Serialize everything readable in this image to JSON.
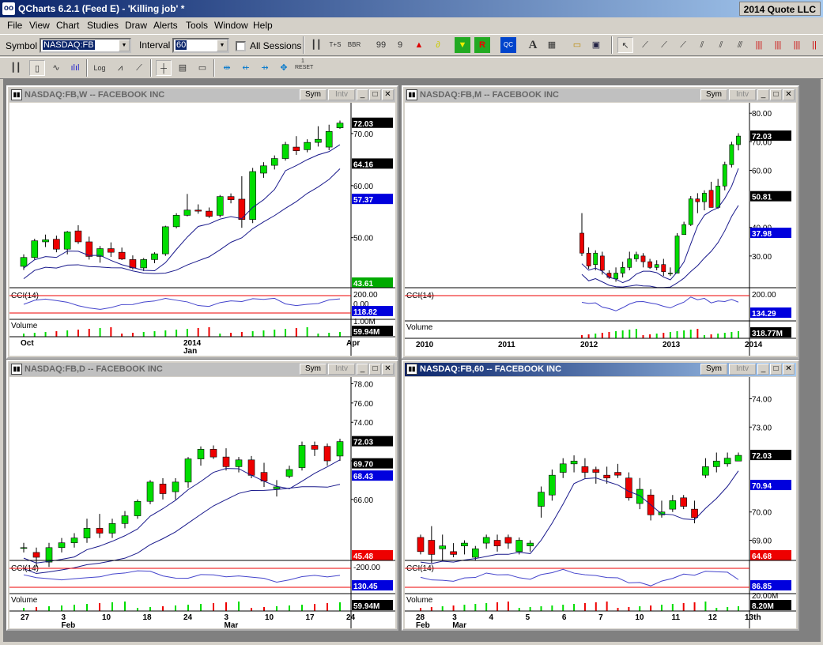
{
  "app": {
    "title": "QCharts 6.2.1 (Feed E) - 'Killing job' *",
    "vendor": "2014 Quote LLC"
  },
  "menu": [
    "File",
    "View",
    "Chart",
    "Studies",
    "Draw",
    "Alerts",
    "Tools",
    "Window",
    "Help"
  ],
  "toolbar": {
    "symbol_label": "Symbol",
    "symbol_value": "NASDAQ:FB",
    "interval_label": "Interval",
    "interval_value": "60",
    "all_sessions_label": "All Sessions",
    "reset_label": "RESET"
  },
  "colors": {
    "up": "#00dd00",
    "down": "#ee0000",
    "ma": "#1a1a8c",
    "cci": "#4444cc",
    "price_tag": "#000000",
    "ma_tag": "#0000dd",
    "low_tag": "#ee0000"
  },
  "charts": [
    {
      "id": "weekly",
      "title": "NASDAQ:FB,W -- FACEBOOK INC",
      "sym": "Sym",
      "intv": "Intv",
      "active": false,
      "chart_data": {
        "type": "candlestick",
        "interval": "W",
        "y_ticks": [
          50,
          60,
          70
        ],
        "y_tick_labels": [
          "50.00",
          "60.00",
          "70.00"
        ],
        "ylim": [
          41,
          75
        ],
        "last_price": "72.03",
        "ma_values": [
          "64.16",
          "57.37"
        ],
        "low_value": "43.61",
        "x_ticks": [
          "Oct",
          "2014\nJan",
          "Apr"
        ],
        "candles": [
          [
            44.5,
            46.8,
            43.8,
            46.2
          ],
          [
            46.2,
            49.8,
            45.8,
            49.4
          ],
          [
            49.2,
            50.6,
            48.2,
            49.6
          ],
          [
            49.7,
            50.4,
            47.2,
            47.8
          ],
          [
            47.8,
            51.3,
            46.8,
            51.1
          ],
          [
            51.3,
            52.4,
            48.8,
            49.2
          ],
          [
            49.2,
            50.2,
            45.8,
            46.4
          ],
          [
            46.4,
            48.4,
            45.2,
            47.9
          ],
          [
            47.9,
            49.1,
            46.3,
            47.2
          ],
          [
            47.2,
            48.1,
            45.7,
            45.9
          ],
          [
            45.8,
            46.6,
            43.9,
            44.2
          ],
          [
            44.2,
            46.1,
            43.6,
            45.8
          ],
          [
            45.8,
            47.2,
            45.1,
            46.9
          ],
          [
            46.9,
            52.3,
            46.5,
            52.1
          ],
          [
            52.1,
            54.7,
            51.8,
            54.3
          ],
          [
            54.3,
            58.4,
            54.1,
            55.3
          ],
          [
            55.3,
            56.4,
            54.6,
            55.1
          ],
          [
            55.1,
            55.8,
            53.8,
            54.1
          ],
          [
            54.3,
            58.2,
            53.9,
            57.9
          ],
          [
            57.9,
            58.5,
            56.6,
            57.3
          ],
          [
            57.4,
            61.8,
            51.9,
            53.5
          ],
          [
            53.5,
            63.4,
            52.8,
            62.7
          ],
          [
            62.4,
            64.5,
            61.5,
            63.8
          ],
          [
            63.9,
            65.8,
            63.1,
            65.2
          ],
          [
            65.2,
            68.4,
            64.8,
            67.9
          ],
          [
            67.4,
            69.5,
            65.9,
            66.7
          ],
          [
            66.9,
            68.9,
            66.4,
            68.3
          ],
          [
            68.3,
            71.4,
            67.5,
            68.9
          ],
          [
            67.4,
            71.7,
            66.8,
            70.4
          ],
          [
            71.1,
            72.5,
            70.9,
            72.0
          ]
        ],
        "cci": {
          "label": "CCI(14)",
          "last": "118.82",
          "levels": [
            "200.00",
            "0.00"
          ]
        },
        "volume": {
          "label": "Volume",
          "last": "59.94M",
          "scale": "1.00M"
        }
      }
    },
    {
      "id": "monthly",
      "title": "NASDAQ:FB,M -- FACEBOOK INC",
      "sym": "Sym",
      "intv": "Intv",
      "active": false,
      "chart_data": {
        "type": "candlestick",
        "interval": "M",
        "y_ticks": [
          30,
          40,
          60,
          70,
          80
        ],
        "y_tick_labels": [
          "30.00",
          "40.00",
          "60.00",
          "70.00",
          "80.00"
        ],
        "ylim": [
          20,
          82
        ],
        "last_price": "72.03",
        "ma_values": [
          "50.81",
          "37.98"
        ],
        "x_ticks": [
          "2010",
          "2011",
          "2012",
          "2013",
          "2014"
        ],
        "candles": [
          [
            38,
            45,
            30,
            31
          ],
          [
            31,
            33,
            25.5,
            26.5
          ],
          [
            27,
            32,
            25,
            31
          ],
          [
            30,
            31.5,
            23.5,
            25
          ],
          [
            24,
            25,
            22,
            22.5
          ],
          [
            22,
            26,
            21,
            24
          ],
          [
            24,
            28,
            22.5,
            26
          ],
          [
            26,
            31.5,
            25,
            29
          ],
          [
            29,
            31.5,
            28,
            30.5
          ],
          [
            30,
            31,
            26,
            28
          ],
          [
            28,
            29,
            25.5,
            26
          ],
          [
            26,
            28.5,
            25,
            27
          ],
          [
            27,
            29,
            23,
            24.5
          ],
          [
            24,
            26,
            23,
            24
          ],
          [
            24,
            38,
            24,
            37
          ],
          [
            37.5,
            42,
            37.5,
            41
          ],
          [
            41,
            51,
            40.5,
            50
          ],
          [
            50,
            52,
            45,
            49
          ],
          [
            49,
            53,
            46,
            52
          ],
          [
            53,
            56,
            47,
            47
          ],
          [
            47,
            57,
            46.5,
            54.5
          ],
          [
            54.5,
            63,
            53,
            62
          ],
          [
            62,
            70,
            61,
            69
          ],
          [
            69,
            73,
            67,
            72
          ]
        ],
        "cci": {
          "label": "CCI(14)",
          "last": "134.29",
          "levels": [
            "200.00"
          ]
        },
        "volume": {
          "label": "Volume",
          "last": "318.77M"
        }
      }
    },
    {
      "id": "daily",
      "title": "NASDAQ:FB,D -- FACEBOOK INC",
      "sym": "Sym",
      "intv": "Intv",
      "active": false,
      "chart_data": {
        "type": "candlestick",
        "interval": "D",
        "y_ticks": [
          66,
          70,
          74,
          76,
          78
        ],
        "y_tick_labels": [
          "66.00",
          "70.00",
          "74.00",
          "76.00",
          "78.00"
        ],
        "ylim": [
          60,
          78.2
        ],
        "last_price": "72.03",
        "ma_values": [
          "69.70",
          "68.43"
        ],
        "low_value": "45.48",
        "x_ticks": [
          "27",
          "3\nFeb",
          "10",
          "18",
          "24",
          "3\nMar",
          "10",
          "17",
          "24"
        ],
        "candles": [
          [
            61,
            61.5,
            60.5,
            61
          ],
          [
            60.5,
            61,
            59,
            60
          ],
          [
            59.5,
            61.5,
            59,
            61
          ],
          [
            61,
            62,
            60.5,
            61.5
          ],
          [
            61.5,
            62.5,
            61,
            62
          ],
          [
            62,
            64,
            61.5,
            63
          ],
          [
            63,
            64.5,
            62,
            62.5
          ],
          [
            62.5,
            64,
            62,
            63.5
          ],
          [
            63.5,
            64.8,
            63,
            64.3
          ],
          [
            64.3,
            66,
            64,
            65.8
          ],
          [
            65.8,
            68,
            65.5,
            67.8
          ],
          [
            67.6,
            68.2,
            66,
            66.6
          ],
          [
            66.8,
            68.2,
            66,
            67.8
          ],
          [
            67.8,
            70.4,
            67.2,
            70.2
          ],
          [
            70.2,
            71.5,
            69.5,
            71.2
          ],
          [
            71.2,
            71.6,
            70.2,
            70.4
          ],
          [
            70.4,
            71.3,
            69,
            69.4
          ],
          [
            69.4,
            70.4,
            68.8,
            70.1
          ],
          [
            70.1,
            70.5,
            68.2,
            68.5
          ],
          [
            68.8,
            69.8,
            67.3,
            67.9
          ],
          [
            67.1,
            68,
            66.3,
            67.3
          ],
          [
            68.4,
            69.5,
            68.2,
            69.1
          ],
          [
            69.3,
            72,
            69,
            71.6
          ],
          [
            71.6,
            72,
            70.5,
            71.2
          ],
          [
            71.5,
            71.8,
            69.5,
            70
          ],
          [
            70.5,
            72.3,
            70,
            72
          ]
        ],
        "cci": {
          "label": "CCI(14)",
          "last": "130.45",
          "levels": [
            "-200.00"
          ]
        },
        "volume": {
          "label": "Volume",
          "last": "59.94M"
        }
      }
    },
    {
      "id": "hourly",
      "title": "NASDAQ:FB,60 -- FACEBOOK INC",
      "sym": "Sym",
      "intv": "Intv",
      "active": true,
      "chart_data": {
        "type": "candlestick",
        "interval": "60",
        "y_ticks": [
          69,
          70,
          73,
          74
        ],
        "y_tick_labels": [
          "69.00",
          "70.00",
          "73.00",
          "74.00"
        ],
        "ylim": [
          68.4,
          74.6
        ],
        "last_price": "72.03",
        "ma_values": [
          "70.94"
        ],
        "low_value": "64.68",
        "x_ticks": [
          "28\nFeb",
          "3\nMar",
          "4",
          "5",
          "6",
          "7",
          "10",
          "11",
          "12",
          "13th"
        ],
        "candles": [
          [
            69.1,
            69.2,
            68.5,
            68.6
          ],
          [
            69,
            69.5,
            68.2,
            68.5
          ],
          [
            68.7,
            69.2,
            68.3,
            68.8
          ],
          [
            68.6,
            68.9,
            68.4,
            68.5
          ],
          [
            68.8,
            69,
            68.5,
            68.9
          ],
          [
            68.4,
            68.8,
            68.3,
            68.7
          ],
          [
            68.9,
            69.2,
            68.7,
            69.1
          ],
          [
            69,
            69.2,
            68.6,
            68.8
          ],
          [
            69.1,
            69.2,
            68.7,
            68.9
          ],
          [
            68.6,
            69.1,
            68.5,
            69
          ],
          [
            68.8,
            69,
            68.6,
            68.9
          ],
          [
            70.2,
            70.9,
            69.8,
            70.7
          ],
          [
            70.6,
            71.5,
            70.4,
            71.3
          ],
          [
            71.4,
            71.9,
            71.2,
            71.7
          ],
          [
            71.7,
            72,
            71.4,
            71.8
          ],
          [
            71.6,
            71.9,
            71.2,
            71.4
          ],
          [
            71.5,
            71.6,
            71,
            71.4
          ],
          [
            71.3,
            71.6,
            71,
            71.2
          ],
          [
            71.4,
            71.7,
            71.2,
            71.3
          ],
          [
            71.2,
            71.4,
            70.4,
            70.5
          ],
          [
            70.3,
            71.2,
            70.1,
            70.8
          ],
          [
            70.6,
            70.8,
            69.7,
            69.9
          ],
          [
            69.9,
            70.4,
            69.8,
            70
          ],
          [
            70.1,
            70.6,
            70,
            70.4
          ],
          [
            70.5,
            70.6,
            70.1,
            70.2
          ],
          [
            70.1,
            70.4,
            69.6,
            69.8
          ],
          [
            71.3,
            71.9,
            71.2,
            71.6
          ],
          [
            71.6,
            72.1,
            71.4,
            71.8
          ],
          [
            71.7,
            72.1,
            71.6,
            71.9
          ],
          [
            71.8,
            72.1,
            71.8,
            72.0
          ]
        ],
        "cci": {
          "label": "CCI(14)",
          "last": "86.85"
        },
        "volume": {
          "label": "Volume",
          "last": "8.20M",
          "scale": "20.00M"
        }
      }
    }
  ]
}
